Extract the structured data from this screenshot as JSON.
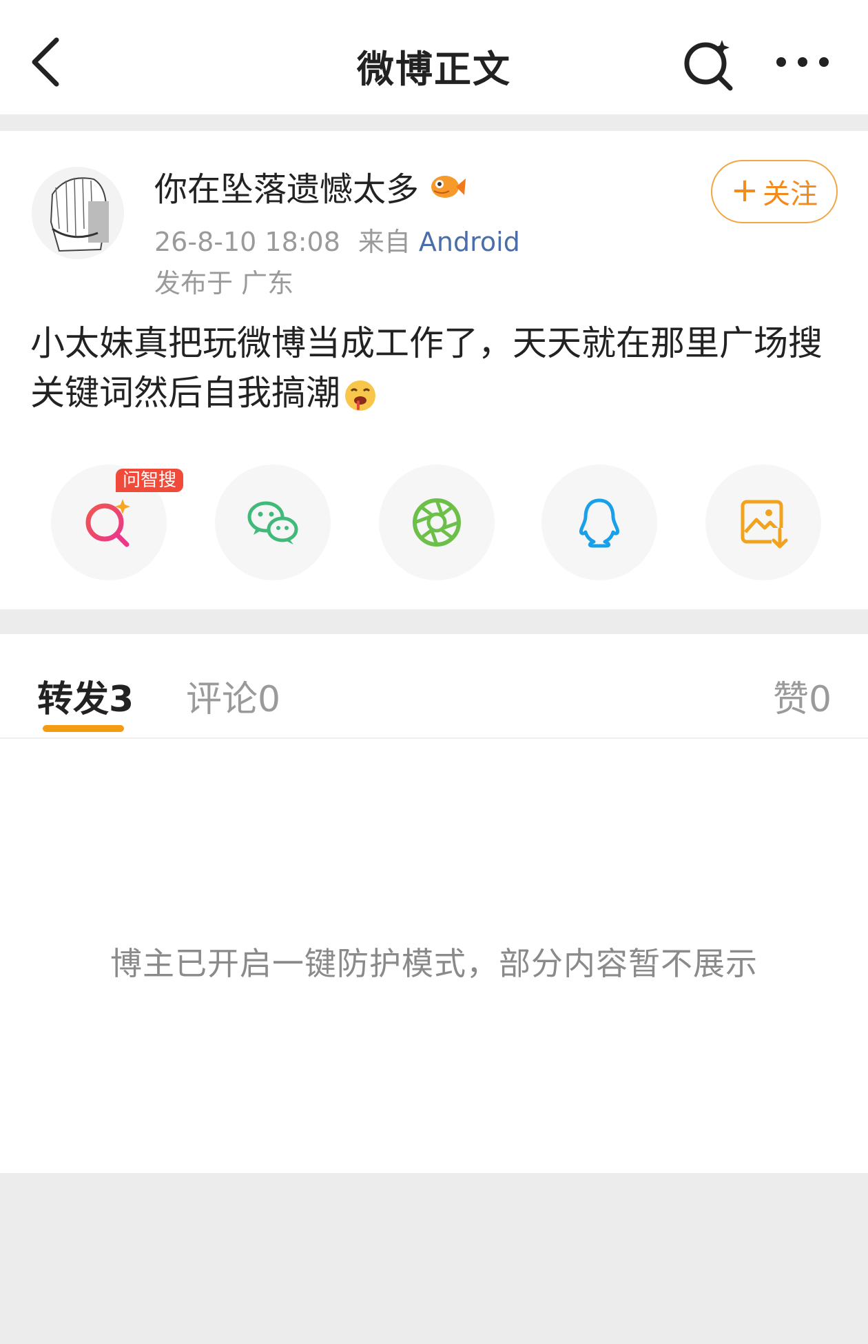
{
  "header": {
    "title": "微博正文"
  },
  "post": {
    "username": "你在坠落遗憾太多",
    "timestamp": "26-8-10 18:08",
    "source_prefix": "来自",
    "source": "Android",
    "location": "发布于 广东",
    "follow_label": "关注",
    "follow_plus": "+",
    "text": "小太妹真把玩微博当成工作了，天天就在那里广场搜关键词然后自我搞潮"
  },
  "share": {
    "ai_tag": "问智搜",
    "buttons": [
      {
        "icon": "ai-search-icon"
      },
      {
        "icon": "wechat-icon"
      },
      {
        "icon": "moments-icon"
      },
      {
        "icon": "qq-icon"
      },
      {
        "icon": "save-image-icon"
      }
    ]
  },
  "tabs": {
    "repost": "转发3",
    "comment": "评论0",
    "like": "赞0"
  },
  "notice": "博主已开启一键防护模式，部分内容暂不展示",
  "colors": {
    "accent": "#f39b11",
    "follow": "#f28a1c",
    "source_link": "#4a6ea9",
    "ai_tag_bg": "#f04a3a"
  }
}
